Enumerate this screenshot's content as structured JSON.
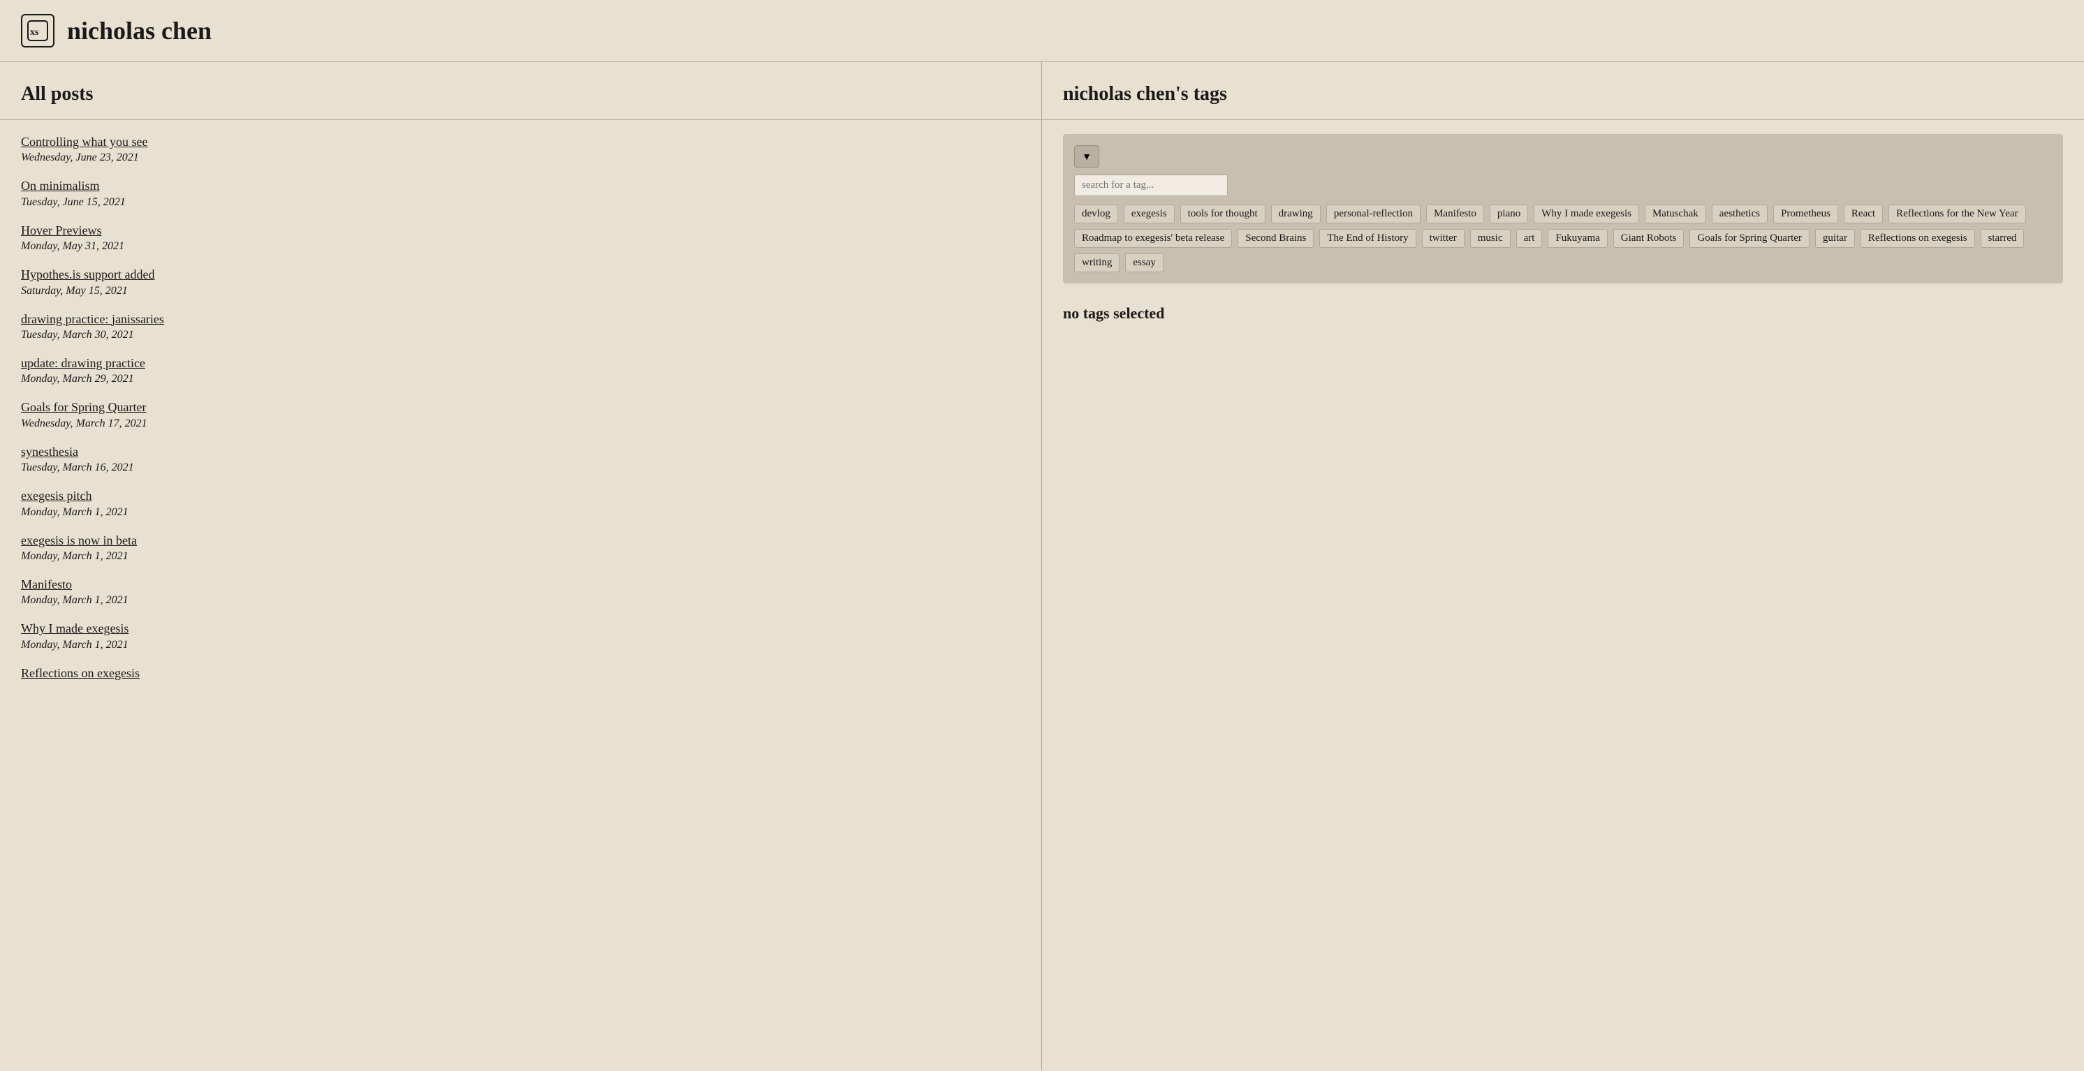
{
  "header": {
    "logo_text": "xs",
    "site_title": "nicholas chen"
  },
  "left_panel": {
    "title": "All posts",
    "posts": [
      {
        "title": "Controlling what you see",
        "date": "Wednesday, June 23, 2021"
      },
      {
        "title": "On minimalism",
        "date": "Tuesday, June 15, 2021"
      },
      {
        "title": "Hover Previews",
        "date": "Monday, May 31, 2021"
      },
      {
        "title": "Hypothes.is support added",
        "date": "Saturday, May 15, 2021"
      },
      {
        "title": "drawing practice: janissaries",
        "date": "Tuesday, March 30, 2021"
      },
      {
        "title": "update: drawing practice",
        "date": "Monday, March 29, 2021"
      },
      {
        "title": "Goals for Spring Quarter",
        "date": "Wednesday, March 17, 2021"
      },
      {
        "title": "synesthesia",
        "date": "Tuesday, March 16, 2021"
      },
      {
        "title": "exegesis pitch",
        "date": "Monday, March 1, 2021"
      },
      {
        "title": "exegesis is now in beta",
        "date": "Monday, March 1, 2021"
      },
      {
        "title": "Manifesto",
        "date": "Monday, March 1, 2021"
      },
      {
        "title": "Why I made exegesis",
        "date": "Monday, March 1, 2021"
      },
      {
        "title": "Reflections on exegesis",
        "date": ""
      }
    ]
  },
  "right_panel": {
    "title": "nicholas chen's tags",
    "search_placeholder": "search for a tag...",
    "tags": [
      "devlog",
      "exegesis",
      "tools for thought",
      "drawing",
      "personal-reflection",
      "Manifesto",
      "piano",
      "Why I made exegesis",
      "Matuschak",
      "aesthetics",
      "Prometheus",
      "React",
      "Reflections for the New Year",
      "Roadmap to exegesis' beta release",
      "Second Brains",
      "The End of History",
      "twitter",
      "music",
      "art",
      "Fukuyama",
      "Giant Robots",
      "Goals for Spring Quarter",
      "guitar",
      "Reflections on exegesis",
      "starred",
      "writing",
      "essay"
    ],
    "no_tags_label": "no tags selected",
    "filter_icon": "▼"
  }
}
